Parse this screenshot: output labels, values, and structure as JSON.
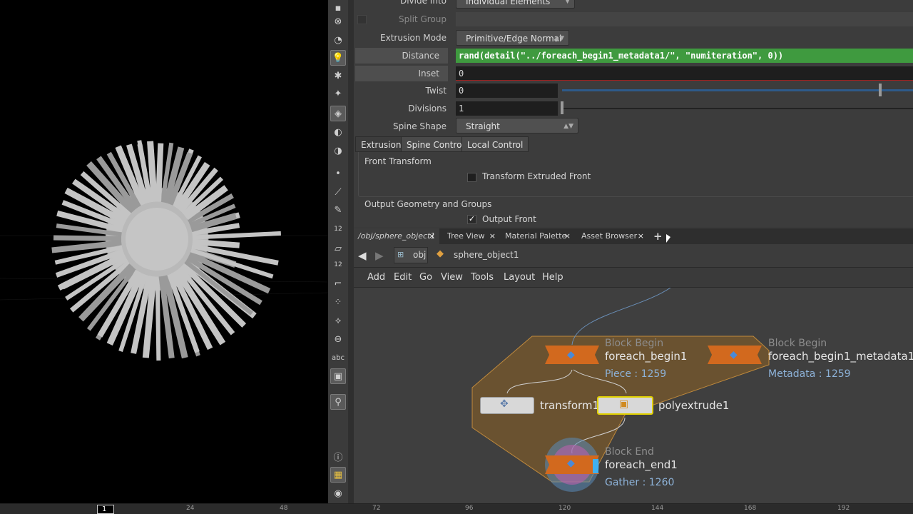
{
  "params": {
    "divide_into": {
      "label": "Divide Into",
      "value": "Individual Elements"
    },
    "split_group": {
      "label": "Split Group"
    },
    "extrusion_mode": {
      "label": "Extrusion Mode",
      "value": "Primitive/Edge Normal"
    },
    "distance": {
      "label": "Distance",
      "value": "rand(detail(\"../foreach_begin1_metadata1/\", \"numiteration\", 0))"
    },
    "inset": {
      "label": "Inset",
      "value": "0"
    },
    "twist": {
      "label": "Twist",
      "value": "0"
    },
    "divisions": {
      "label": "Divisions",
      "value": "1"
    },
    "spine_shape": {
      "label": "Spine Shape",
      "value": "Straight"
    },
    "tabs": [
      "Extrusion",
      "Spine Control",
      "Local Control"
    ],
    "front_transform": {
      "title": "Front Transform",
      "checkbox": "Transform Extruded Front"
    },
    "output_geometry": {
      "title": "Output Geometry and Groups",
      "checkbox": "Output Front"
    }
  },
  "pane_tabs": [
    {
      "label": "/obj/sphere_object1"
    },
    {
      "label": "Tree View"
    },
    {
      "label": "Material Palette"
    },
    {
      "label": "Asset Browser"
    }
  ],
  "add_tab": "+",
  "close_glyph": "×",
  "path": {
    "obj": "obj",
    "object": "sphere_object1"
  },
  "menu": [
    "Add",
    "Edit",
    "Go",
    "View",
    "Tools",
    "Layout",
    "Help"
  ],
  "nodes": {
    "foreach_begin1": {
      "type": "Block Begin",
      "name": "foreach_begin1",
      "info": "Piece : 1259"
    },
    "foreach_begin1_metadata1": {
      "type": "Block Begin",
      "name": "foreach_begin1_metadata1",
      "info": "Metadata : 1259"
    },
    "transform1": {
      "name": "transform1"
    },
    "polyextrude1": {
      "name": "polyextrude1"
    },
    "foreach_end1": {
      "type": "Block End",
      "name": "foreach_end1",
      "info": "Gather : 1260"
    }
  },
  "toolbar_text": {
    "num12a": "12",
    "num12b": "12",
    "abc": "abc"
  },
  "timeline": {
    "current_frame": "1",
    "ticks": [
      "24",
      "48",
      "72",
      "96",
      "120",
      "144",
      "168",
      "192"
    ]
  },
  "colors": {
    "distance_field": "#3f9a3f",
    "block_network": "#7a5a2c",
    "node_orange": "#d2691e",
    "selected_node_outline": "#e0d000",
    "info_blue": "#8db2d8"
  }
}
